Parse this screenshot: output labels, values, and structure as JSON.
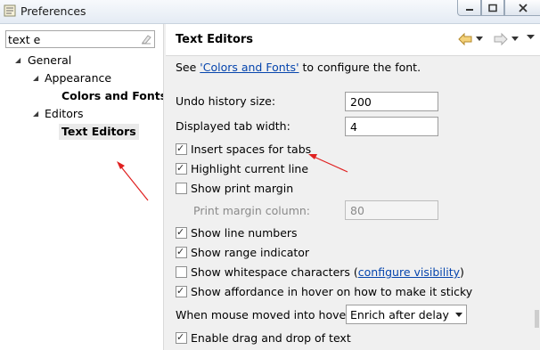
{
  "window": {
    "title": "Preferences"
  },
  "filter": {
    "value": "text e"
  },
  "tree": {
    "general": "General",
    "appearance": "Appearance",
    "colors_and_fonts": "Colors and Fonts",
    "editors": "Editors",
    "text_editors": "Text Editors"
  },
  "page": {
    "title": "Text Editors",
    "see_prefix": "See ",
    "see_link": "'Colors and Fonts'",
    "see_suffix": " to configure the font.",
    "undo_label": "Undo history size:",
    "undo_value": "200",
    "tab_label": "Displayed tab width:",
    "tab_value": "4",
    "insert_spaces": "Insert spaces for tabs",
    "highlight_line": "Highlight current line",
    "show_margin": "Show print margin",
    "margin_column_label": "Print margin column:",
    "margin_column_value": "80",
    "show_line_numbers": "Show line numbers",
    "show_range": "Show range indicator",
    "show_whitespace_prefix": "Show whitespace characters (",
    "show_whitespace_link": "configure visibility",
    "show_whitespace_suffix": ")",
    "show_affordance": "Show affordance in hover on how to make it sticky",
    "hover_label": "When mouse moved into hover:",
    "hover_value": "Enrich after delay",
    "drag_drop": "Enable drag and drop of text"
  },
  "checkboxes": {
    "insert_spaces": true,
    "highlight_line": true,
    "show_margin": false,
    "show_line_numbers": true,
    "show_range": true,
    "show_whitespace": false,
    "show_affordance": true,
    "drag_drop": true
  },
  "colors": {
    "annotation_arrow": "#e02020",
    "link": "#0645ad"
  }
}
